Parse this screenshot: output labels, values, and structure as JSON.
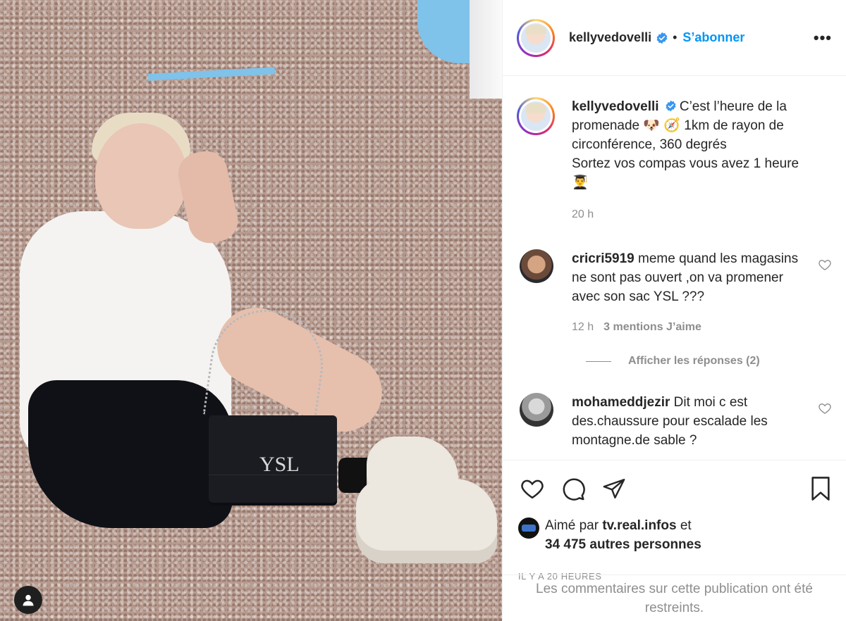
{
  "post": {
    "photo_alt": "Photo by kellyvedovelli",
    "bag_logo": "YSL"
  },
  "header": {
    "username": "kellyvedovelli",
    "separator": "•",
    "follow_label": "S’abonner",
    "more_label": "•••"
  },
  "caption": {
    "username": "kellyvedovelli",
    "line1": "C’est l’heure de la",
    "line2": "promenade 🐶  🧭  1km de rayon de",
    "line3": "circonférence, 360 degrés",
    "line4": "Sortez vos compas vous avez 1 heure",
    "line5": "👨‍🎓",
    "time": "20 h"
  },
  "comments": [
    {
      "username": "cricri5919",
      "text": "meme quand les magasins ne sont pas ouvert ,on va promener avec son sac YSL ???",
      "time": "12 h",
      "likes": "3 mentions J’aime",
      "replies": "Afficher les réponses (2)"
    },
    {
      "username": "mohameddjezir",
      "text": "Dit moi c est des.chaussure pour escalade les montagne.de sable ?"
    }
  ],
  "liked_by": {
    "prefix": "Aimé par",
    "user": "tv.real.infos",
    "suffix": "et",
    "others": "34 475 autres personnes"
  },
  "posted_ago": "IL Y A 20 HEURES",
  "restricted_notice": "Les commentaires sur cette publication ont été restreints.",
  "icons": {
    "verified": "verified-badge-icon",
    "like": "heart-icon",
    "comment": "comment-bubble-icon",
    "share": "paper-plane-icon",
    "save": "bookmark-icon",
    "tag": "user-tag-icon"
  },
  "colors": {
    "accent": "#0095f6",
    "text": "#262626",
    "muted": "#8e8e8e",
    "border": "#efefef"
  }
}
